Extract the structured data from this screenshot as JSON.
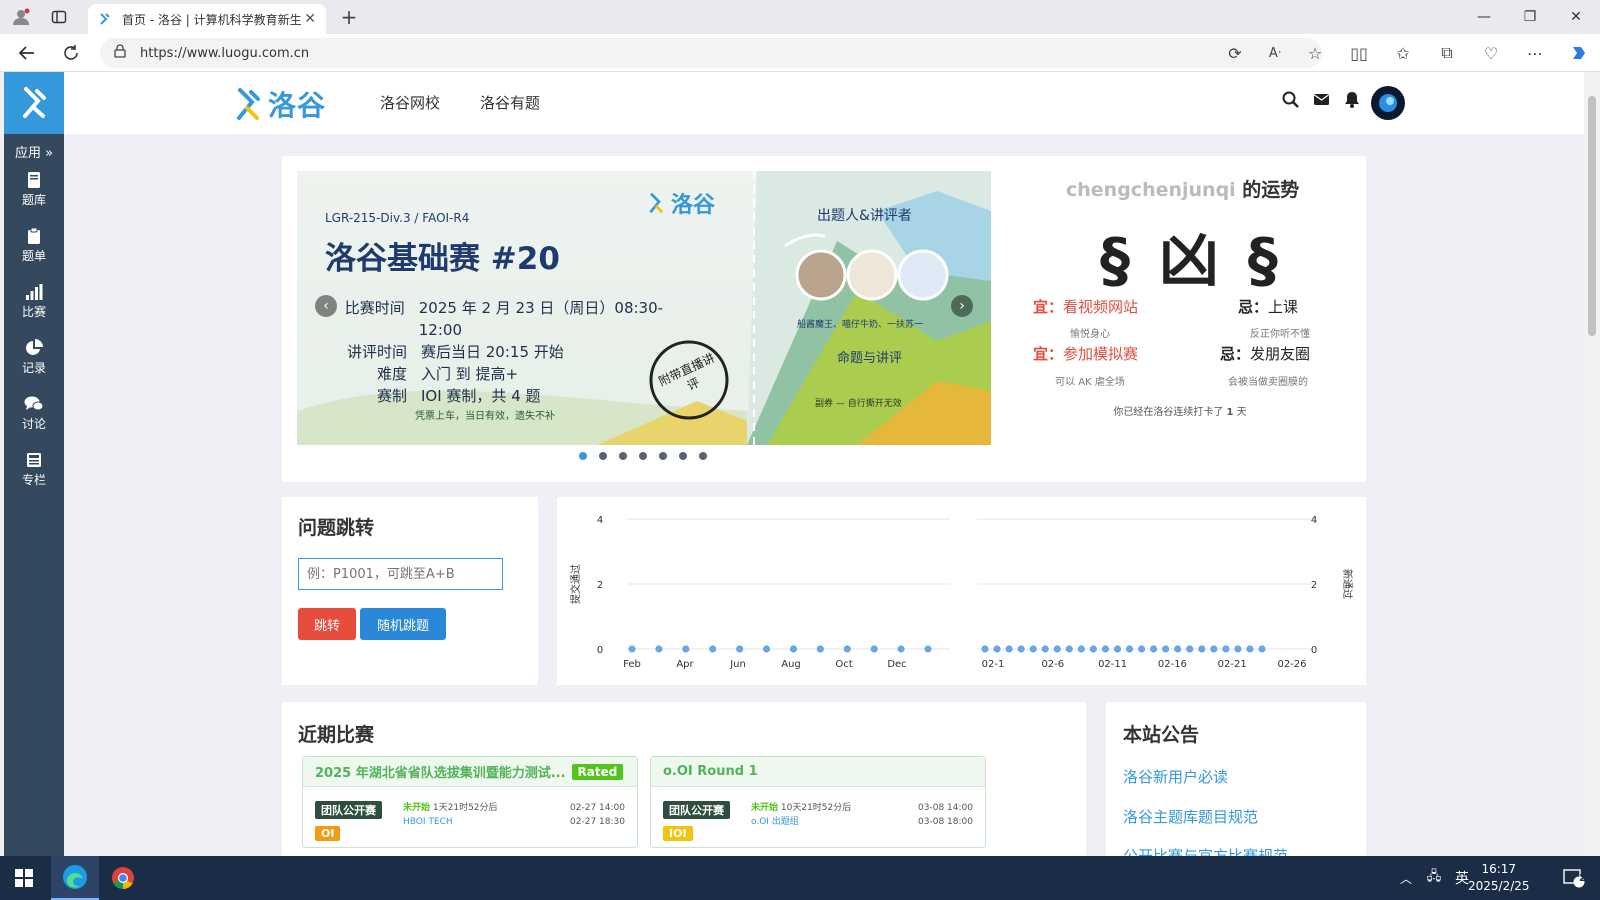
{
  "browser": {
    "tab_title": "首页 - 洛谷 | 计算机科学教育新生",
    "url": "https://www.luogu.com.cn"
  },
  "sidebar": {
    "apps_label": "应用",
    "items": [
      {
        "label": "题库",
        "icon": "book-icon"
      },
      {
        "label": "题单",
        "icon": "clipboard-icon"
      },
      {
        "label": "比赛",
        "icon": "bar-chart-icon"
      },
      {
        "label": "记录",
        "icon": "pie-chart-icon"
      },
      {
        "label": "讨论",
        "icon": "comments-icon"
      },
      {
        "label": "专栏",
        "icon": "newspaper-icon"
      }
    ]
  },
  "header": {
    "brand": "洛谷",
    "nav": [
      "洛谷网校",
      "洛谷有题"
    ]
  },
  "banner": {
    "brand": "洛谷",
    "subtitle": "LGR-215-Div.3 / FAOI-R4",
    "title": "洛谷基础赛 #20",
    "rows": [
      {
        "k": "比赛时间",
        "v": "2025 年 2 月 23 日（周日）08:30-12:00"
      },
      {
        "k": "讲评时间",
        "v": "赛后当日 20:15 开始"
      },
      {
        "k": "难度",
        "v": "入门 到 提高+"
      },
      {
        "k": "赛制",
        "v": "IOI 赛制，共 4 题"
      }
    ],
    "slogan": "凭票上车，当日有效，遗失不补",
    "stamp": "附带直播讲评",
    "setters_title": "出题人&讲评者",
    "setters": "船酱魔王、喵仔牛奶、一扶苏一",
    "side_title": "命题与讲评",
    "side_slogan": "副券 — 自行撕开无效",
    "slide_count": 7,
    "active_slide": 0
  },
  "fortune": {
    "user": "chengchenjunqi",
    "suffix": " 的运势",
    "result": "§ 凶 §",
    "good_prefix": "宜：",
    "bad_prefix": "忌：",
    "good": [
      {
        "item": "看视频网站",
        "desc": "愉悦身心"
      },
      {
        "item": "参加模拟赛",
        "desc": "可以 AK 虐全场"
      }
    ],
    "bad": [
      {
        "item": "上课",
        "desc": "反正你听不懂"
      },
      {
        "item": "发朋友圈",
        "desc": "会被当做卖圈膜的"
      }
    ],
    "streak_pre": "你已经在洛谷连续打卡了",
    "streak_days": "1",
    "streak_post": "天"
  },
  "jump": {
    "title": "问题跳转",
    "placeholder": "例：P1001，可跳至A+B",
    "jump_button": "跳转",
    "random_button": "随机跳题"
  },
  "chart_data": [
    {
      "type": "scatter",
      "ylabel": "提交通过",
      "yticks": [
        0,
        2,
        4
      ],
      "ylim": [
        0,
        4
      ],
      "tick_labels": [
        "Feb",
        "Apr",
        "Jun",
        "Aug",
        "Oct",
        "Dec"
      ],
      "values": [
        0,
        0,
        0,
        0,
        0,
        0,
        0,
        0,
        0,
        0,
        0,
        0
      ]
    },
    {
      "type": "scatter",
      "ylabel": "新通过",
      "yticks": [
        0,
        2,
        4
      ],
      "ylim": [
        0,
        4
      ],
      "tick_labels": [
        "02-1",
        "02-6",
        "02-11",
        "02-16",
        "02-21",
        "02-26"
      ],
      "values": [
        0,
        0,
        0,
        0,
        0,
        0,
        0,
        0,
        0,
        0,
        0,
        0,
        0,
        0,
        0,
        0,
        0,
        0,
        0,
        0,
        0,
        0,
        0,
        0
      ]
    }
  ],
  "contests": {
    "title": "近期比赛",
    "items": [
      {
        "name": "2025 年湖北省省队选拔集训暨能力测试...",
        "rated": "Rated",
        "type": "团队公开赛",
        "rule": "OI",
        "status": "未开始",
        "countdown": "1天21时52分后",
        "host": "HBOI TECH",
        "start": "02-27 14:00",
        "end": "02-27 18:30"
      },
      {
        "name": "o.OI Round 1",
        "rated": "",
        "type": "团队公开赛",
        "rule": "IOI",
        "status": "未开始",
        "countdown": "10天21时52分后",
        "host": "o.OI 出题组",
        "start": "03-08 14:00",
        "end": "03-08 18:00"
      }
    ]
  },
  "notice": {
    "title": "本站公告",
    "links": [
      "洛谷新用户必读",
      "洛谷主题库题目规范",
      "公开比赛与官方比赛规范"
    ]
  },
  "taskbar": {
    "ime": "英",
    "time": "16:17",
    "date": "2025/2/25",
    "notifications": "2"
  },
  "colors": {
    "primary": "#3498db",
    "sidebar": "#34495e",
    "danger": "#e74c3c",
    "success": "#52c41a",
    "warning": "#f39c11"
  }
}
